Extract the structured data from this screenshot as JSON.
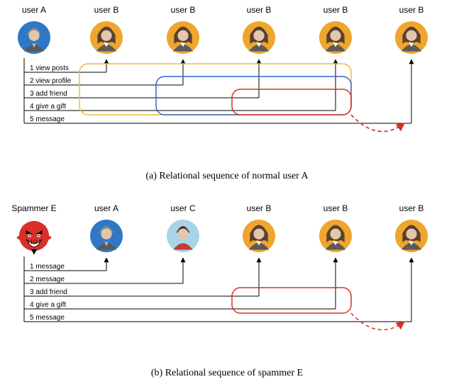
{
  "panel_a": {
    "caption": "(a) Relational sequence of normal user A",
    "users": [
      {
        "label": "user A",
        "type": "user_a"
      },
      {
        "label": "user B",
        "type": "woman"
      },
      {
        "label": "user B",
        "type": "woman"
      },
      {
        "label": "user B",
        "type": "woman"
      },
      {
        "label": "user B",
        "type": "woman"
      },
      {
        "label": "user B",
        "type": "woman"
      }
    ],
    "actions": [
      "1 view posts",
      "2 view profile",
      "3 add friend",
      "4 give a gift",
      "5 message"
    ],
    "groups": [
      {
        "color": "#f4b93f",
        "members": [
          1,
          2,
          3,
          4
        ],
        "style": "rounded"
      },
      {
        "color": "#3366cc",
        "members": [
          2,
          3,
          4
        ],
        "style": "rounded"
      },
      {
        "color": "#d93025",
        "members": [
          3,
          4
        ],
        "style": "rounded"
      }
    ]
  },
  "panel_b": {
    "caption": "(b) Relational sequence of spammer E",
    "users": [
      {
        "label": "Spammer E",
        "type": "spammer"
      },
      {
        "label": "user A",
        "type": "user_a"
      },
      {
        "label": "user C",
        "type": "user_c"
      },
      {
        "label": "user B",
        "type": "woman"
      },
      {
        "label": "user B",
        "type": "woman"
      },
      {
        "label": "user B",
        "type": "woman"
      }
    ],
    "actions": [
      "1 message",
      "2 message",
      "3 add friend",
      "4 give a gift",
      "5 message"
    ],
    "groups": [
      {
        "color": "#d93025",
        "members": [
          3,
          4
        ],
        "style": "rounded"
      }
    ]
  },
  "colors": {
    "orange_avatar": "#efa52e",
    "blue_avatar": "#2f78c4",
    "lightblue_avatar": "#a7d4e8",
    "spammer_red": "#d9302a",
    "gray_suit": "#5a5a5a",
    "skin": "#e4c6aa",
    "hair": "#5a4030"
  }
}
